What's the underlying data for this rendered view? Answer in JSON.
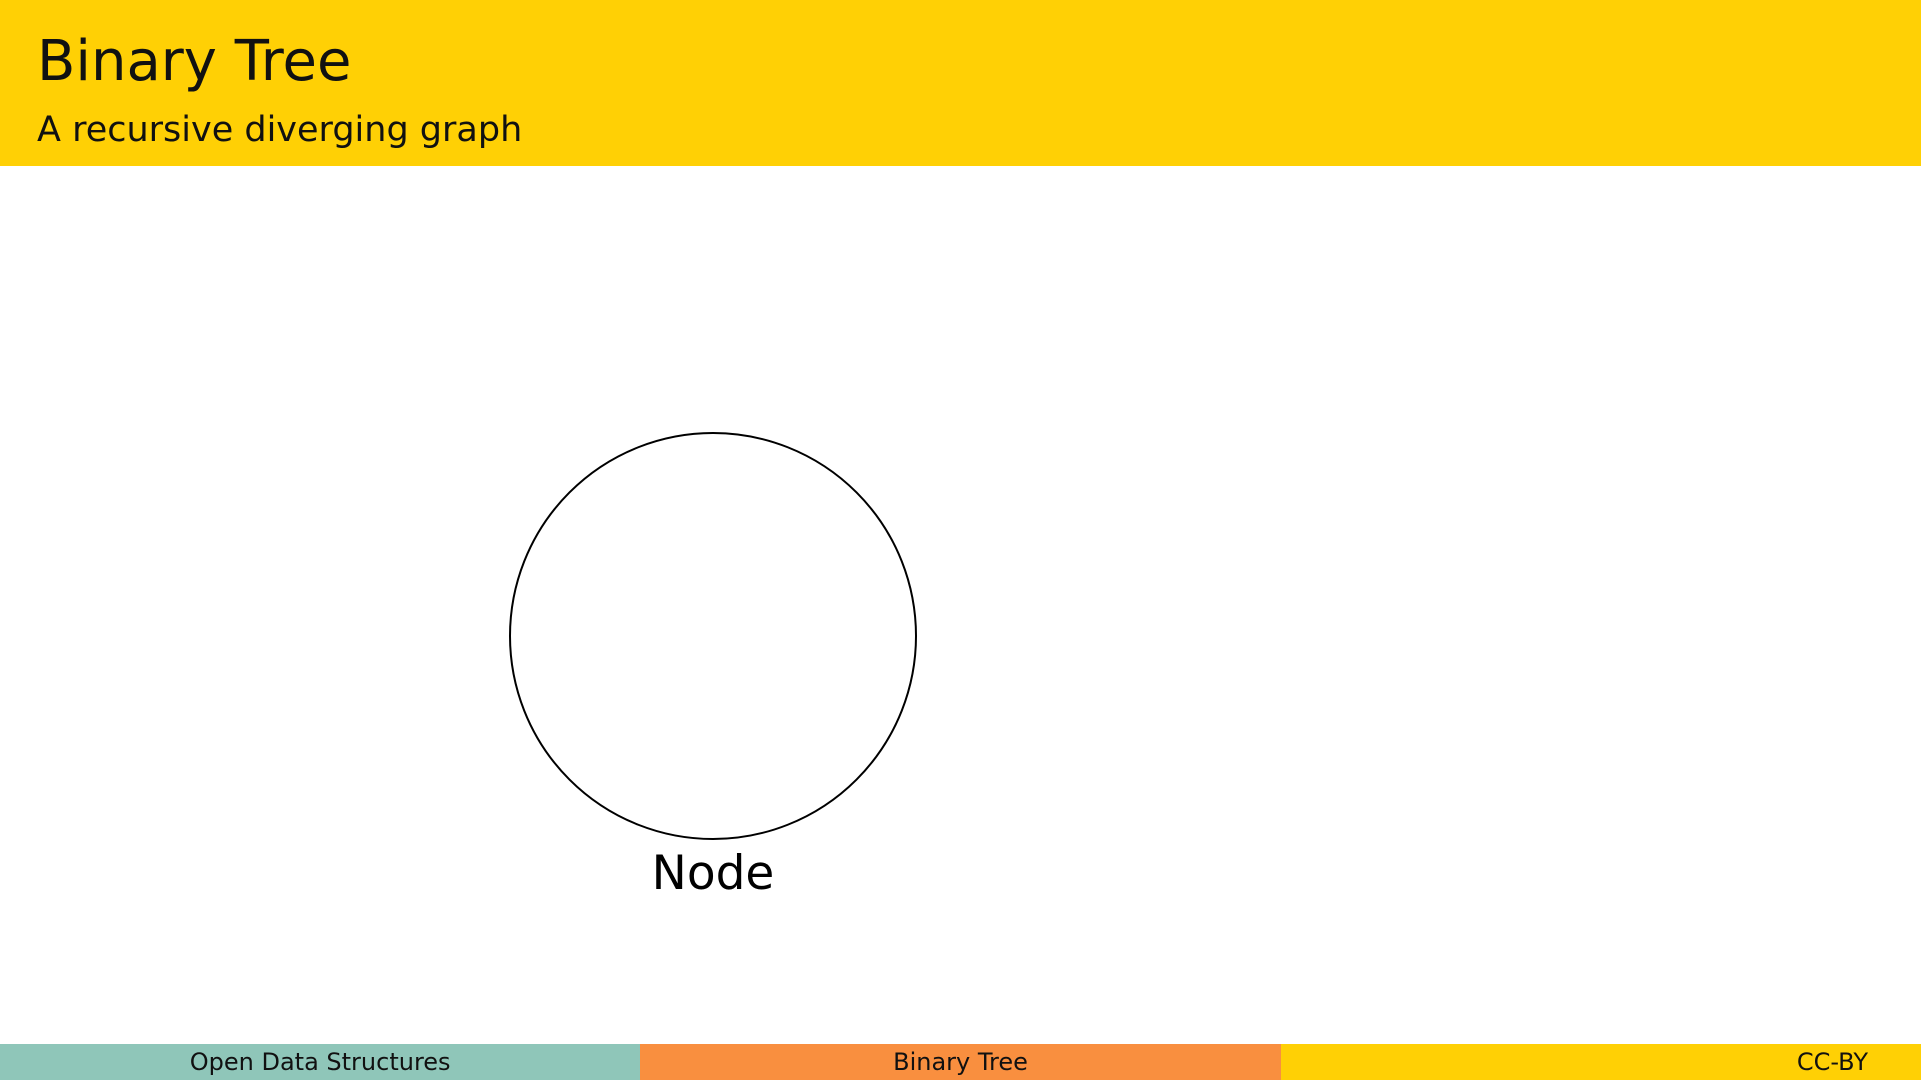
{
  "header": {
    "title": "Binary Tree",
    "subtitle": "A recursive diverging graph"
  },
  "diagram": {
    "node_label": "Node"
  },
  "footer": {
    "left": "Open Data Structures",
    "center": "Binary Tree",
    "right": "CC-BY"
  },
  "colors": {
    "header_bg": "#FFD005",
    "footer_left": "#8FC6B9",
    "footer_center": "#F98F3F",
    "footer_right": "#FFD005"
  }
}
